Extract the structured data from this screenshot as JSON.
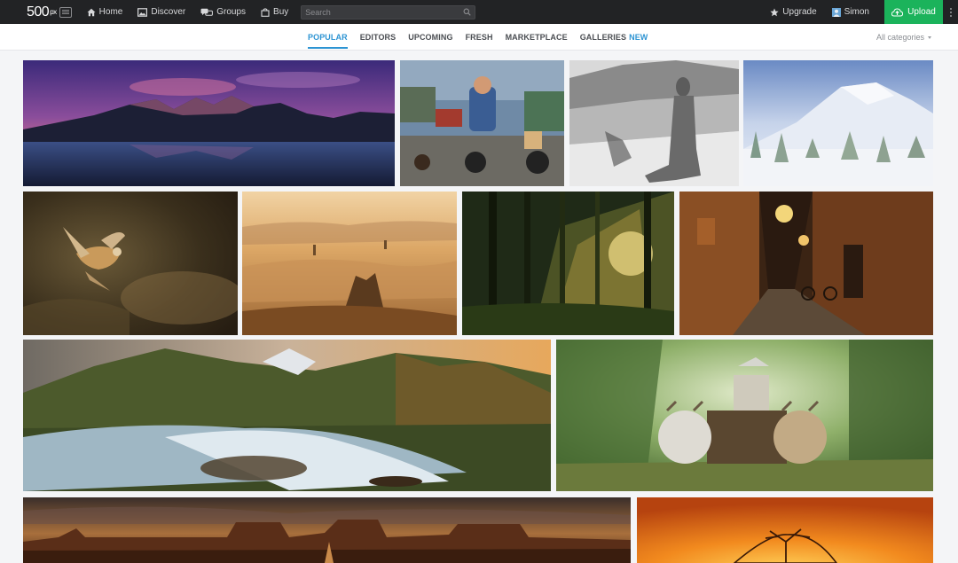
{
  "header": {
    "logo": {
      "text": "500",
      "superscript": "px"
    },
    "nav": [
      {
        "label": "Home",
        "icon": "home-icon"
      },
      {
        "label": "Discover",
        "icon": "picture-icon"
      },
      {
        "label": "Groups",
        "icon": "chat-bubbles-icon"
      },
      {
        "label": "Buy",
        "icon": "shopping-bag-icon"
      }
    ],
    "search": {
      "placeholder": "Search",
      "value": ""
    },
    "upgrade_label": "Upgrade",
    "user_name": "Simon",
    "upload_label": "Upload"
  },
  "tabs": [
    {
      "label": "POPULAR",
      "active": true
    },
    {
      "label": "EDITORS",
      "active": false
    },
    {
      "label": "UPCOMING",
      "active": false
    },
    {
      "label": "FRESH",
      "active": false
    },
    {
      "label": "MARKETPLACE",
      "active": false
    },
    {
      "label": "GALLERIES",
      "badge": "NEW",
      "active": false
    }
  ],
  "category_filter": {
    "selected": "All categories"
  },
  "photos": [
    {
      "subject": "mountain range reflected in lake at dusk"
    },
    {
      "subject": "boy riding go-kart with chickens"
    },
    {
      "subject": "black and white nude figure in snowy dunes"
    },
    {
      "subject": "snow-covered trees and mountain"
    },
    {
      "subject": "small bird in flight"
    },
    {
      "subject": "golden hazy rolling hills"
    },
    {
      "subject": "sunbeams through forest"
    },
    {
      "subject": "narrow old-town alley at night"
    },
    {
      "subject": "waterfall river in mountain valley"
    },
    {
      "subject": "farmer on ox cart in green forest"
    },
    {
      "subject": "desert buttes under dramatic sky"
    },
    {
      "subject": "silhouette tree against orange sunset"
    }
  ],
  "colors": {
    "topbar_bg": "#222325",
    "accent_blue": "#2d94d3",
    "upload_green": "#1bb35b",
    "page_bg": "#f4f5f7"
  }
}
